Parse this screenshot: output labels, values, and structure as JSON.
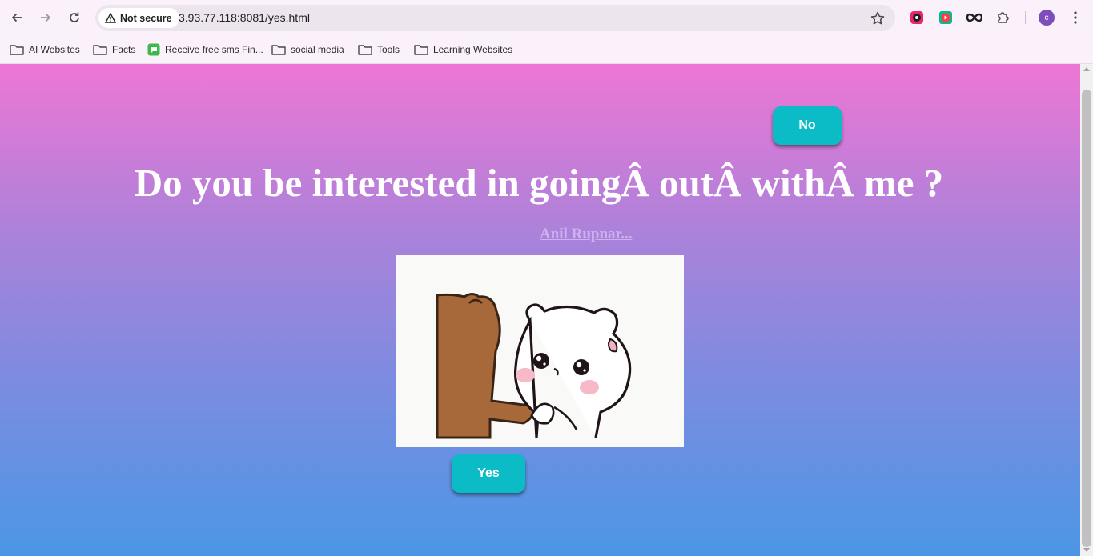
{
  "browser": {
    "security_label": "Not secure",
    "url": "3.93.77.118:8081/yes.html",
    "profile_initial": "c"
  },
  "bookmarks": [
    {
      "label": "AI Websites",
      "icon": "folder-icon"
    },
    {
      "label": "Facts",
      "icon": "folder-icon"
    },
    {
      "label": "Receive free sms Fin...",
      "icon": "sms-site-icon"
    },
    {
      "label": "social media",
      "icon": "folder-icon"
    },
    {
      "label": "Tools",
      "icon": "folder-icon"
    },
    {
      "label": "Learning Websites",
      "icon": "folder-icon"
    }
  ],
  "page": {
    "no_label": "No",
    "question": "Do you be interested in goingÂ outÂ withÂ me ?",
    "author": "Anil Rupnar...",
    "yes_label": "Yes"
  },
  "colors": {
    "gradient_top": "#ee76d5",
    "gradient_bottom": "#4b97e5",
    "button": "#0bbcc6",
    "author_link": "#cdb2f0"
  }
}
